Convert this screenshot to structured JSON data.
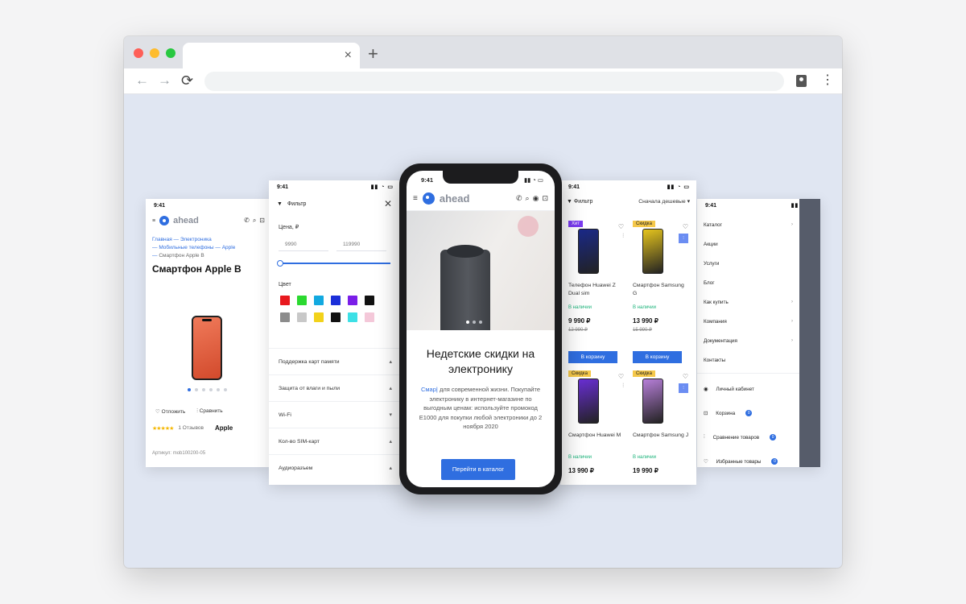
{
  "browser": {
    "tab_close": "×",
    "new_tab": "+",
    "back": "←",
    "forward": "→",
    "reload": "⟳",
    "menu": "⋮"
  },
  "status_time": "9:41",
  "logo_text": "ahead",
  "product_screen": {
    "breadcrumbs": [
      "Главная",
      "Электроника",
      "Мобильные телефоны",
      "Apple",
      "Смартфон Apple B"
    ],
    "title": "Смартфон Apple B",
    "defer_label": "Отложить",
    "compare_label": "Сравнить",
    "stars": "★★★★★",
    "reviews": "1 Отзывов",
    "brand": "Apple",
    "sku": "Артикул: mob100200-05"
  },
  "filter_screen": {
    "title": "Фильтр",
    "price_label": "Цена, ₽",
    "price_min": "9990",
    "price_max": "119990",
    "color_label": "Цвет",
    "colors": [
      "#e8191e",
      "#2bd930",
      "#12a9e0",
      "#1b2fd9",
      "#7a1ee8",
      "#111111",
      "#8c8c8c",
      "#c8c8c8",
      "#f2d21b",
      "#111111",
      "#3de0e6",
      "#f4c8d9"
    ],
    "rows": [
      {
        "label": "Поддержка карт памяти",
        "arrow": "▴"
      },
      {
        "label": "Защита от влаги и пыли",
        "arrow": "▴"
      },
      {
        "label": "Wi-Fi",
        "arrow": "▾"
      },
      {
        "label": "Кол-во SIM-карт",
        "arrow": "▴"
      },
      {
        "label": "Аудиоразъем",
        "arrow": "▴"
      }
    ]
  },
  "home_screen": {
    "promo_title": "Недетские скидки на электронику",
    "promo_text_highlight": "Смар|",
    "promo_text": " для современной жизни. Покупайте электронику в интернет-магазине по выгодным ценам: используйте промокод E1000 для покупки любой электроники до 2 ноября 2020",
    "cta_button": "Перейти в каталог"
  },
  "catalog_screen": {
    "filter_label": "Фильтр",
    "sort_label": "Сначала дешевые ▾",
    "products": [
      {
        "badge": "Хит",
        "badge_type": "hit",
        "name": "Телефон Huawei Z Dual sim",
        "stock": "В наличии",
        "price": "9 990 ₽",
        "old_price": "12 990 ₽",
        "button": "В корзину",
        "color": "#1b2a8a"
      },
      {
        "badge": "Скидка",
        "badge_type": "sale",
        "name": "Смартфон Samsung G",
        "stock": "В наличии",
        "price": "13 990 ₽",
        "old_price": "15 990 ₽",
        "button": "В корзину",
        "color": "#e6c51d"
      },
      {
        "badge": "Скидка",
        "badge_type": "sale",
        "name": "Смартфон Huawei M",
        "stock": "В наличии",
        "price": "13 990 ₽",
        "old_price": "",
        "button": "",
        "color": "#6a2fd6"
      },
      {
        "badge": "Скидка",
        "badge_type": "sale",
        "name": "Смартфон Samsung J",
        "stock": "В наличии",
        "price": "19 990 ₽",
        "old_price": "",
        "button": "",
        "color": "#b77fd9"
      }
    ]
  },
  "menu_screen": {
    "items": [
      {
        "label": "Каталог",
        "arrow": "›"
      },
      {
        "label": "Акции",
        "arrow": ""
      },
      {
        "label": "Услуги",
        "arrow": ""
      },
      {
        "label": "Блог",
        "arrow": ""
      },
      {
        "label": "Как купить",
        "arrow": "›"
      },
      {
        "label": "Компания",
        "arrow": "›"
      },
      {
        "label": "Документация",
        "arrow": "›"
      },
      {
        "label": "Контакты",
        "arrow": ""
      }
    ],
    "account": "Личный кабинет",
    "cart": "Корзина",
    "cart_count": "0",
    "compare": "Сравнение товаров",
    "compare_count": "0",
    "favorites": "Избранные товары",
    "favorites_count": "0"
  }
}
